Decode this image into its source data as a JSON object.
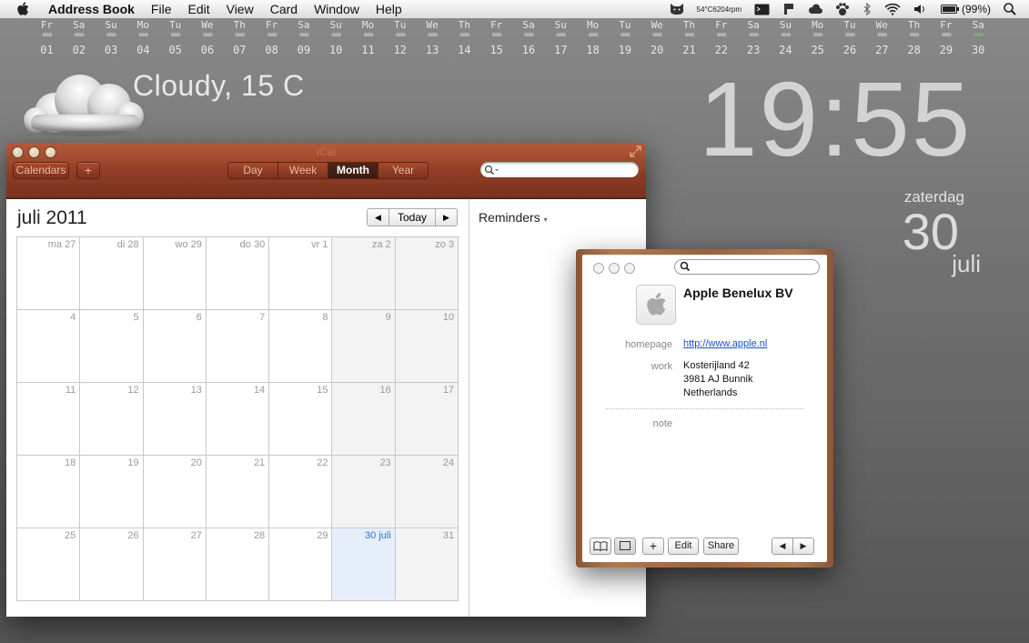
{
  "menubar": {
    "app_name": "Address Book",
    "items": [
      "File",
      "Edit",
      "View",
      "Card",
      "Window",
      "Help"
    ],
    "temperature": "54°C",
    "fan_speed": "6204rpm",
    "battery": "(99%)"
  },
  "strip": {
    "days": [
      {
        "dn": "Fr",
        "num": "01"
      },
      {
        "dn": "Sa",
        "num": "02"
      },
      {
        "dn": "Su",
        "num": "03"
      },
      {
        "dn": "Mo",
        "num": "04"
      },
      {
        "dn": "Tu",
        "num": "05"
      },
      {
        "dn": "We",
        "num": "06"
      },
      {
        "dn": "Th",
        "num": "07"
      },
      {
        "dn": "Fr",
        "num": "08"
      },
      {
        "dn": "Sa",
        "num": "09"
      },
      {
        "dn": "Su",
        "num": "10"
      },
      {
        "dn": "Mo",
        "num": "11"
      },
      {
        "dn": "Tu",
        "num": "12"
      },
      {
        "dn": "We",
        "num": "13"
      },
      {
        "dn": "Th",
        "num": "14"
      },
      {
        "dn": "Fr",
        "num": "15"
      },
      {
        "dn": "Sa",
        "num": "16"
      },
      {
        "dn": "Su",
        "num": "17"
      },
      {
        "dn": "Mo",
        "num": "18"
      },
      {
        "dn": "Tu",
        "num": "19"
      },
      {
        "dn": "We",
        "num": "20"
      },
      {
        "dn": "Th",
        "num": "21"
      },
      {
        "dn": "Fr",
        "num": "22"
      },
      {
        "dn": "Sa",
        "num": "23"
      },
      {
        "dn": "Su",
        "num": "24"
      },
      {
        "dn": "Mo",
        "num": "25"
      },
      {
        "dn": "Tu",
        "num": "26"
      },
      {
        "dn": "We",
        "num": "27"
      },
      {
        "dn": "Th",
        "num": "28"
      },
      {
        "dn": "Fr",
        "num": "29"
      },
      {
        "dn": "Sa",
        "num": "30"
      }
    ],
    "bar": "==",
    "today_index": 29
  },
  "weather": {
    "text": "Cloudy, 15 C"
  },
  "clock": {
    "time": "19:55",
    "weekday": "zaterdag",
    "day": "30",
    "month": "juli"
  },
  "ical": {
    "title": "iCal",
    "calendars_label": "Calendars",
    "add_label": "+",
    "views": [
      "Day",
      "Week",
      "Month",
      "Year"
    ],
    "active_view": "Month",
    "month_title": "juli 2011",
    "nav_prev": "◀",
    "nav_today": "Today",
    "nav_next": "▶",
    "reminders_label": "Reminders",
    "weeks": [
      [
        "ma 27",
        "di 28",
        "wo 29",
        "do 30",
        "vr 1",
        "za 2",
        "zo 3"
      ],
      [
        "4",
        "5",
        "6",
        "7",
        "8",
        "9",
        "10"
      ],
      [
        "11",
        "12",
        "13",
        "14",
        "15",
        "16",
        "17"
      ],
      [
        "18",
        "19",
        "20",
        "21",
        "22",
        "23",
        "24"
      ],
      [
        "25",
        "26",
        "27",
        "28",
        "29",
        "30 juli",
        "31"
      ]
    ],
    "today_cell": "30 juli"
  },
  "address_book": {
    "company": "Apple Benelux BV",
    "homepage_label": "homepage",
    "homepage_url": "http://www.apple.nl",
    "work_label": "work",
    "address_lines": [
      "Kosterijland 42",
      "3981 AJ Bunnik",
      "Netherlands"
    ],
    "note_label": "note",
    "add_label": "+",
    "edit_label": "Edit",
    "share_label": "Share",
    "prev": "◀",
    "next": "▶"
  }
}
